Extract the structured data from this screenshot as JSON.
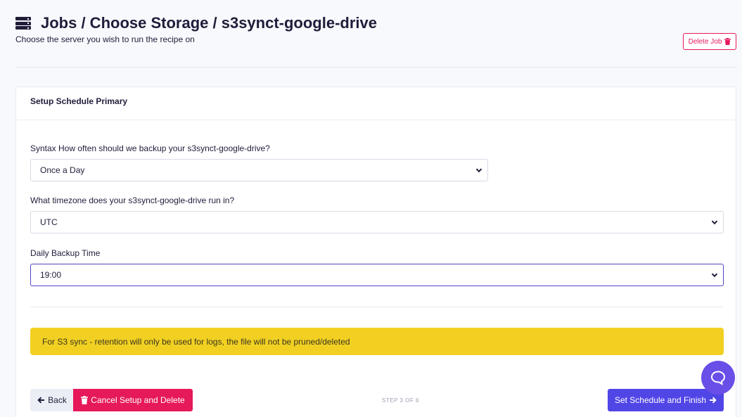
{
  "header": {
    "title": "Jobs / Choose Storage / s3synct-google-drive",
    "subtitle": "Choose the server you wish to run the recipe on",
    "delete_label": "Delete Job"
  },
  "card": {
    "title": "Setup Schedule Primary",
    "fields": [
      {
        "label": "Syntax How often should we backup your s3synct-google-drive?",
        "value": "Once a Day"
      },
      {
        "label": "What timezone does your s3synct-google-drive run in?",
        "value": "UTC"
      },
      {
        "label": "Daily Backup Time",
        "value": "19:00"
      }
    ],
    "alert": "For S3 sync - retention will only be used for logs, the file will not be pruned/deleted"
  },
  "footer": {
    "back_label": "Back",
    "cancel_label": "Cancel Setup and Delete",
    "step_label": "STEP 3 OF 6",
    "finish_label": "Set Schedule and Finish"
  },
  "colors": {
    "accent": "#5046e6",
    "danger": "#e6195a",
    "warning": "#f2d022",
    "help": "#6a4ee8"
  },
  "icons": [
    "server-icon",
    "trash-icon",
    "chevron-down-icon",
    "arrow-left-icon",
    "arrow-right-icon",
    "chat-icon"
  ]
}
